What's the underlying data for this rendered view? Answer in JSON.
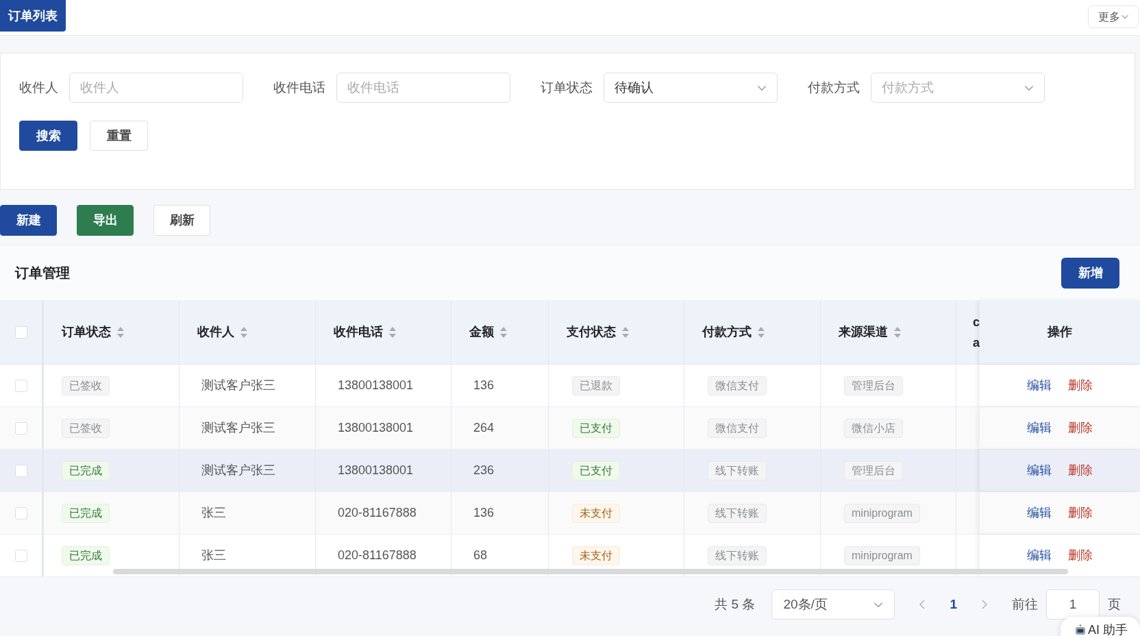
{
  "top_tab": {
    "label": "订单列表",
    "selected": true
  },
  "more_button": {
    "label": "更多"
  },
  "filters": [
    {
      "label": "收件人",
      "kind": "input",
      "placeholder": "收件人"
    },
    {
      "label": "收件电话",
      "kind": "input",
      "placeholder": "收件电话"
    },
    {
      "label": "订单状态",
      "kind": "select",
      "value": "待确认"
    },
    {
      "label": "付款方式",
      "kind": "select",
      "placeholder": "付款方式"
    }
  ],
  "search_buttons": [
    {
      "label": "搜索",
      "kind": "primary"
    },
    {
      "label": "重置",
      "kind": "plain"
    }
  ],
  "toolbar": [
    {
      "label": "新建",
      "kind": "primary"
    },
    {
      "label": "导出",
      "kind": "success"
    },
    {
      "label": "刷新",
      "kind": "plain"
    }
  ],
  "table": {
    "title": "订单管理",
    "add_button": "新增",
    "select_all_checked": false,
    "columns": [
      {
        "label": "订单状态",
        "sortable": true
      },
      {
        "label": "收件人",
        "sortable": true
      },
      {
        "label": "收件电话",
        "sortable": true
      },
      {
        "label": "金额",
        "sortable": true
      },
      {
        "label": "支付状态",
        "sortable": true
      },
      {
        "label": "付款方式",
        "sortable": true
      },
      {
        "label": "来源渠道",
        "sortable": true
      }
    ],
    "column_8_lines": [
      "c",
      "a"
    ],
    "action_column": "操作",
    "rows": [
      {
        "checked": false,
        "highlighted": false,
        "status": {
          "text": "已签收",
          "kind": "info"
        },
        "name": "测试客户张三",
        "phone": "13800138001",
        "amount": "136",
        "pay_status": {
          "text": "已退款",
          "kind": "info"
        },
        "pay_method": {
          "text": "微信支付",
          "kind": "info"
        },
        "channel": {
          "text": "管理后台",
          "kind": "info"
        },
        "actions": [
          "编辑",
          "删除"
        ]
      },
      {
        "checked": false,
        "highlighted": false,
        "status": {
          "text": "已签收",
          "kind": "info"
        },
        "name": "测试客户张三",
        "phone": "13800138001",
        "amount": "264",
        "pay_status": {
          "text": "已支付",
          "kind": "success"
        },
        "pay_method": {
          "text": "微信支付",
          "kind": "info"
        },
        "channel": {
          "text": "微信小店",
          "kind": "info"
        },
        "actions": [
          "编辑",
          "删除"
        ]
      },
      {
        "checked": false,
        "highlighted": true,
        "status": {
          "text": "已完成",
          "kind": "success"
        },
        "name": "测试客户张三",
        "phone": "13800138001",
        "amount": "236",
        "pay_status": {
          "text": "已支付",
          "kind": "success"
        },
        "pay_method": {
          "text": "线下转账",
          "kind": "info"
        },
        "channel": {
          "text": "管理后台",
          "kind": "info"
        },
        "actions": [
          "编辑",
          "删除"
        ]
      },
      {
        "checked": false,
        "highlighted": false,
        "status": {
          "text": "已完成",
          "kind": "success"
        },
        "name": "张三",
        "phone": "020-81167888",
        "amount": "136",
        "pay_status": {
          "text": "未支付",
          "kind": "warning"
        },
        "pay_method": {
          "text": "线下转账",
          "kind": "info"
        },
        "channel": {
          "text": "miniprogram",
          "kind": "info"
        },
        "actions": [
          "编辑",
          "删除"
        ]
      },
      {
        "checked": false,
        "highlighted": false,
        "status": {
          "text": "已完成",
          "kind": "success"
        },
        "name": "张三",
        "phone": "020-81167888",
        "amount": "68",
        "pay_status": {
          "text": "未支付",
          "kind": "warning"
        },
        "pay_method": {
          "text": "线下转账",
          "kind": "info"
        },
        "channel": {
          "text": "miniprogram",
          "kind": "info"
        },
        "actions": [
          "编辑",
          "删除"
        ]
      }
    ]
  },
  "pagination": {
    "total": "共 5 条",
    "page_size": "20条/页",
    "pages": [
      {
        "label": "1",
        "selected": true
      }
    ],
    "goto_label": "前往",
    "goto_value": "1",
    "page_suffix": "页"
  },
  "assistant": {
    "label": "AI 助手"
  }
}
